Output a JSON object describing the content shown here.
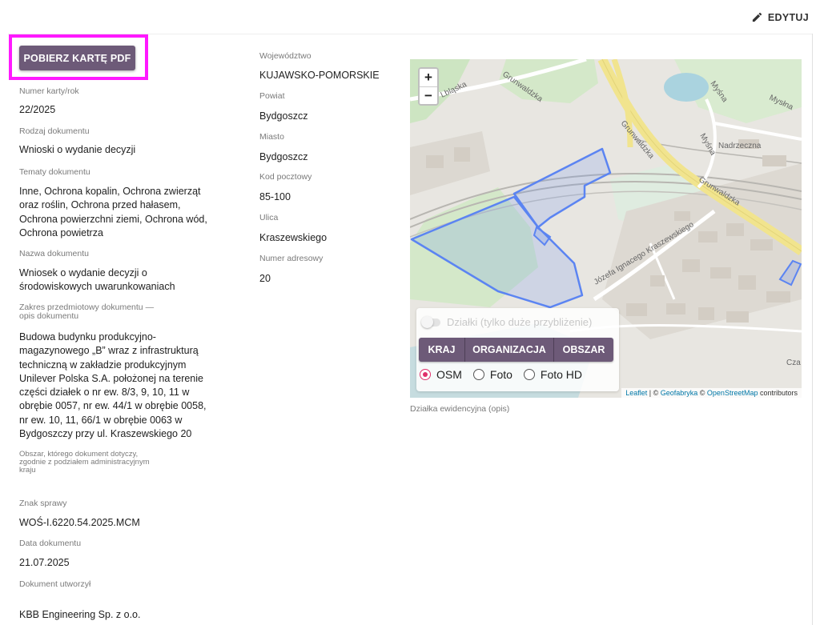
{
  "header": {
    "edit_label": "EDYTUJ"
  },
  "pdf_button": "POBIERZ KARTĘ PDF",
  "left": {
    "card_number": {
      "label": "Numer karty/rok",
      "value": "22/2025"
    },
    "doc_type": {
      "label": "Rodzaj dokumentu",
      "value": "Wnioski o wydanie decyzji"
    },
    "topics": {
      "label": "Tematy dokumentu",
      "value": "Inne, Ochrona kopalin, Ochrona zwierząt oraz roślin, Ochrona przed hałasem, Ochrona powierzchni ziemi, Ochrona wód, Ochrona powietrza"
    },
    "doc_name": {
      "label": "Nazwa dokumentu",
      "value": "Wniosek o wydanie decyzji o środowiskowych uwarunkowaniach"
    },
    "scope": {
      "label_line1": "Zakres przedmiotowy dokumentu —",
      "label_line2": "opis dokumentu",
      "value": "Budowa budynku produkcyjno-magazynowego „B” wraz z infrastrukturą techniczną w zakładzie produkcyjnym Unilever Polska S.A. położonej na terenie części działek o nr ew. 8/3, 9, 10, 11 w obrębie 0057, nr ew. 44/1 w obrębie 0058, nr ew. 10, 11, 66/1 w obrębie 0063 w Bydgoszczy przy ul. Kraszewskiego 20"
    },
    "area": {
      "label_line1": "Obszar, którego dokument dotyczy,",
      "label_line2": "zgodnie z podziałem administracyjnym",
      "label_line3": "kraju",
      "value": ""
    },
    "case_sign": {
      "label": "Znak sprawy",
      "value": "WOŚ-I.6220.54.2025.MCM"
    },
    "doc_date": {
      "label": "Data dokumentu",
      "value": "21.07.2025"
    },
    "created_by": {
      "label": "Dokument utworzył",
      "value": "KBB Engineering Sp. z o.o."
    }
  },
  "middle": {
    "voivodeship": {
      "label": "Województwo",
      "value": "KUJAWSKO-POMORSKIE"
    },
    "county": {
      "label": "Powiat",
      "value": "Bydgoszcz"
    },
    "city": {
      "label": "Miasto",
      "value": "Bydgoszcz"
    },
    "postal_code": {
      "label": "Kod pocztowy",
      "value": "85-100"
    },
    "street": {
      "label": "Ulica",
      "value": "Kraszewskiego"
    },
    "address_number": {
      "label": "Numer adresowy",
      "value": "20"
    }
  },
  "map": {
    "zoom_in": "+",
    "zoom_out": "−",
    "street_labels": {
      "grunwaldzka_1": "Grunwaldzka",
      "grunwaldzka_2": "Grunwaldzka",
      "grunwaldzka_3": "Grunwaldzka",
      "hlaska": "Lbląska",
      "myslna_1": "Myśna",
      "myslna_2": "Mysłna",
      "myslna_3": "Myśna",
      "nadrzeczna": "Nadrzeczna",
      "kraszewskiego": "Józefa Ignacego Kraszewskiego",
      "cza": "Cza"
    },
    "parcels_toggle": "Działki (tylko duże przybliżenie)",
    "segments": [
      "KRAJ",
      "ORGANIZACJA",
      "OBSZAR"
    ],
    "layers": [
      "OSM",
      "Foto",
      "Foto HD"
    ],
    "selected_layer": "OSM",
    "attribution": {
      "leaflet": "Leaflet",
      "sep1": " | © ",
      "geofabryka": "Geofabryka",
      "sep2": " © ",
      "osm": "OpenStreetMap",
      "contributors": " contributors"
    },
    "caption": "Działka ewidencyjna (opis)",
    "colors": {
      "polygon": "#5b84f2",
      "road_yellow": "#f1e48e",
      "water": "#aad3df",
      "green": "#cfe6c5",
      "button": "#6d5a78"
    }
  }
}
